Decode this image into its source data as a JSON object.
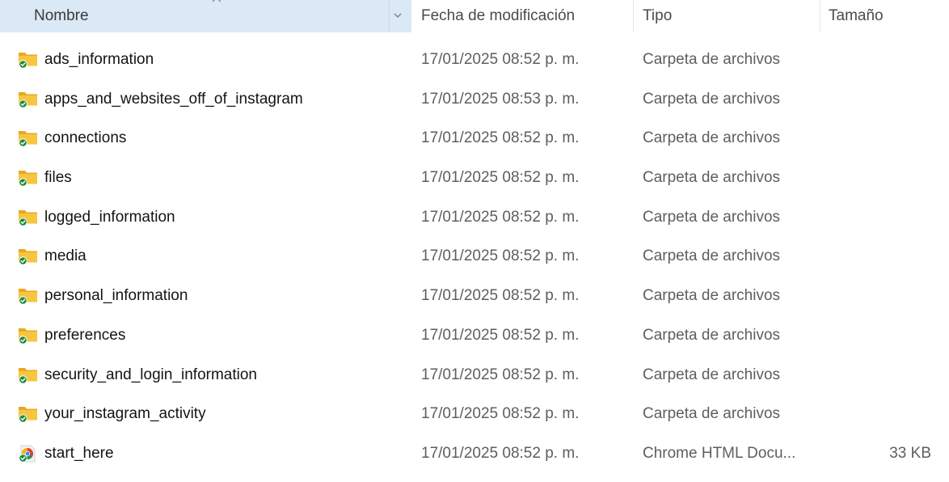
{
  "columns": {
    "name": "Nombre",
    "date": "Fecha de modificación",
    "type": "Tipo",
    "size": "Tamaño"
  },
  "colors": {
    "header_selected_bg": "#dbe8f6",
    "folder_yellow": "#f7c640",
    "sync_badge_green": "#1f8a3a",
    "chrome_red": "#db4437",
    "chrome_yellow": "#f4b400",
    "chrome_green": "#0f9d58",
    "chrome_blue": "#4285f4"
  },
  "files": [
    {
      "name": "ads_information",
      "date": "17/01/2025 08:52 p. m.",
      "type": "Carpeta de archivos",
      "size": "",
      "icon": "folder-synced-icon"
    },
    {
      "name": "apps_and_websites_off_of_instagram",
      "date": "17/01/2025 08:53 p. m.",
      "type": "Carpeta de archivos",
      "size": "",
      "icon": "folder-synced-icon"
    },
    {
      "name": "connections",
      "date": "17/01/2025 08:52 p. m.",
      "type": "Carpeta de archivos",
      "size": "",
      "icon": "folder-synced-icon"
    },
    {
      "name": "files",
      "date": "17/01/2025 08:52 p. m.",
      "type": "Carpeta de archivos",
      "size": "",
      "icon": "folder-synced-icon"
    },
    {
      "name": "logged_information",
      "date": "17/01/2025 08:52 p. m.",
      "type": "Carpeta de archivos",
      "size": "",
      "icon": "folder-synced-icon"
    },
    {
      "name": "media",
      "date": "17/01/2025 08:52 p. m.",
      "type": "Carpeta de archivos",
      "size": "",
      "icon": "folder-synced-icon"
    },
    {
      "name": "personal_information",
      "date": "17/01/2025 08:52 p. m.",
      "type": "Carpeta de archivos",
      "size": "",
      "icon": "folder-synced-icon"
    },
    {
      "name": "preferences",
      "date": "17/01/2025 08:52 p. m.",
      "type": "Carpeta de archivos",
      "size": "",
      "icon": "folder-synced-icon"
    },
    {
      "name": "security_and_login_information",
      "date": "17/01/2025 08:52 p. m.",
      "type": "Carpeta de archivos",
      "size": "",
      "icon": "folder-synced-icon"
    },
    {
      "name": "your_instagram_activity",
      "date": "17/01/2025 08:52 p. m.",
      "type": "Carpeta de archivos",
      "size": "",
      "icon": "folder-synced-icon"
    },
    {
      "name": "start_here",
      "date": "17/01/2025 08:52 p. m.",
      "type": "Chrome HTML Docu...",
      "size": "33 KB",
      "icon": "chrome-html-icon"
    }
  ]
}
